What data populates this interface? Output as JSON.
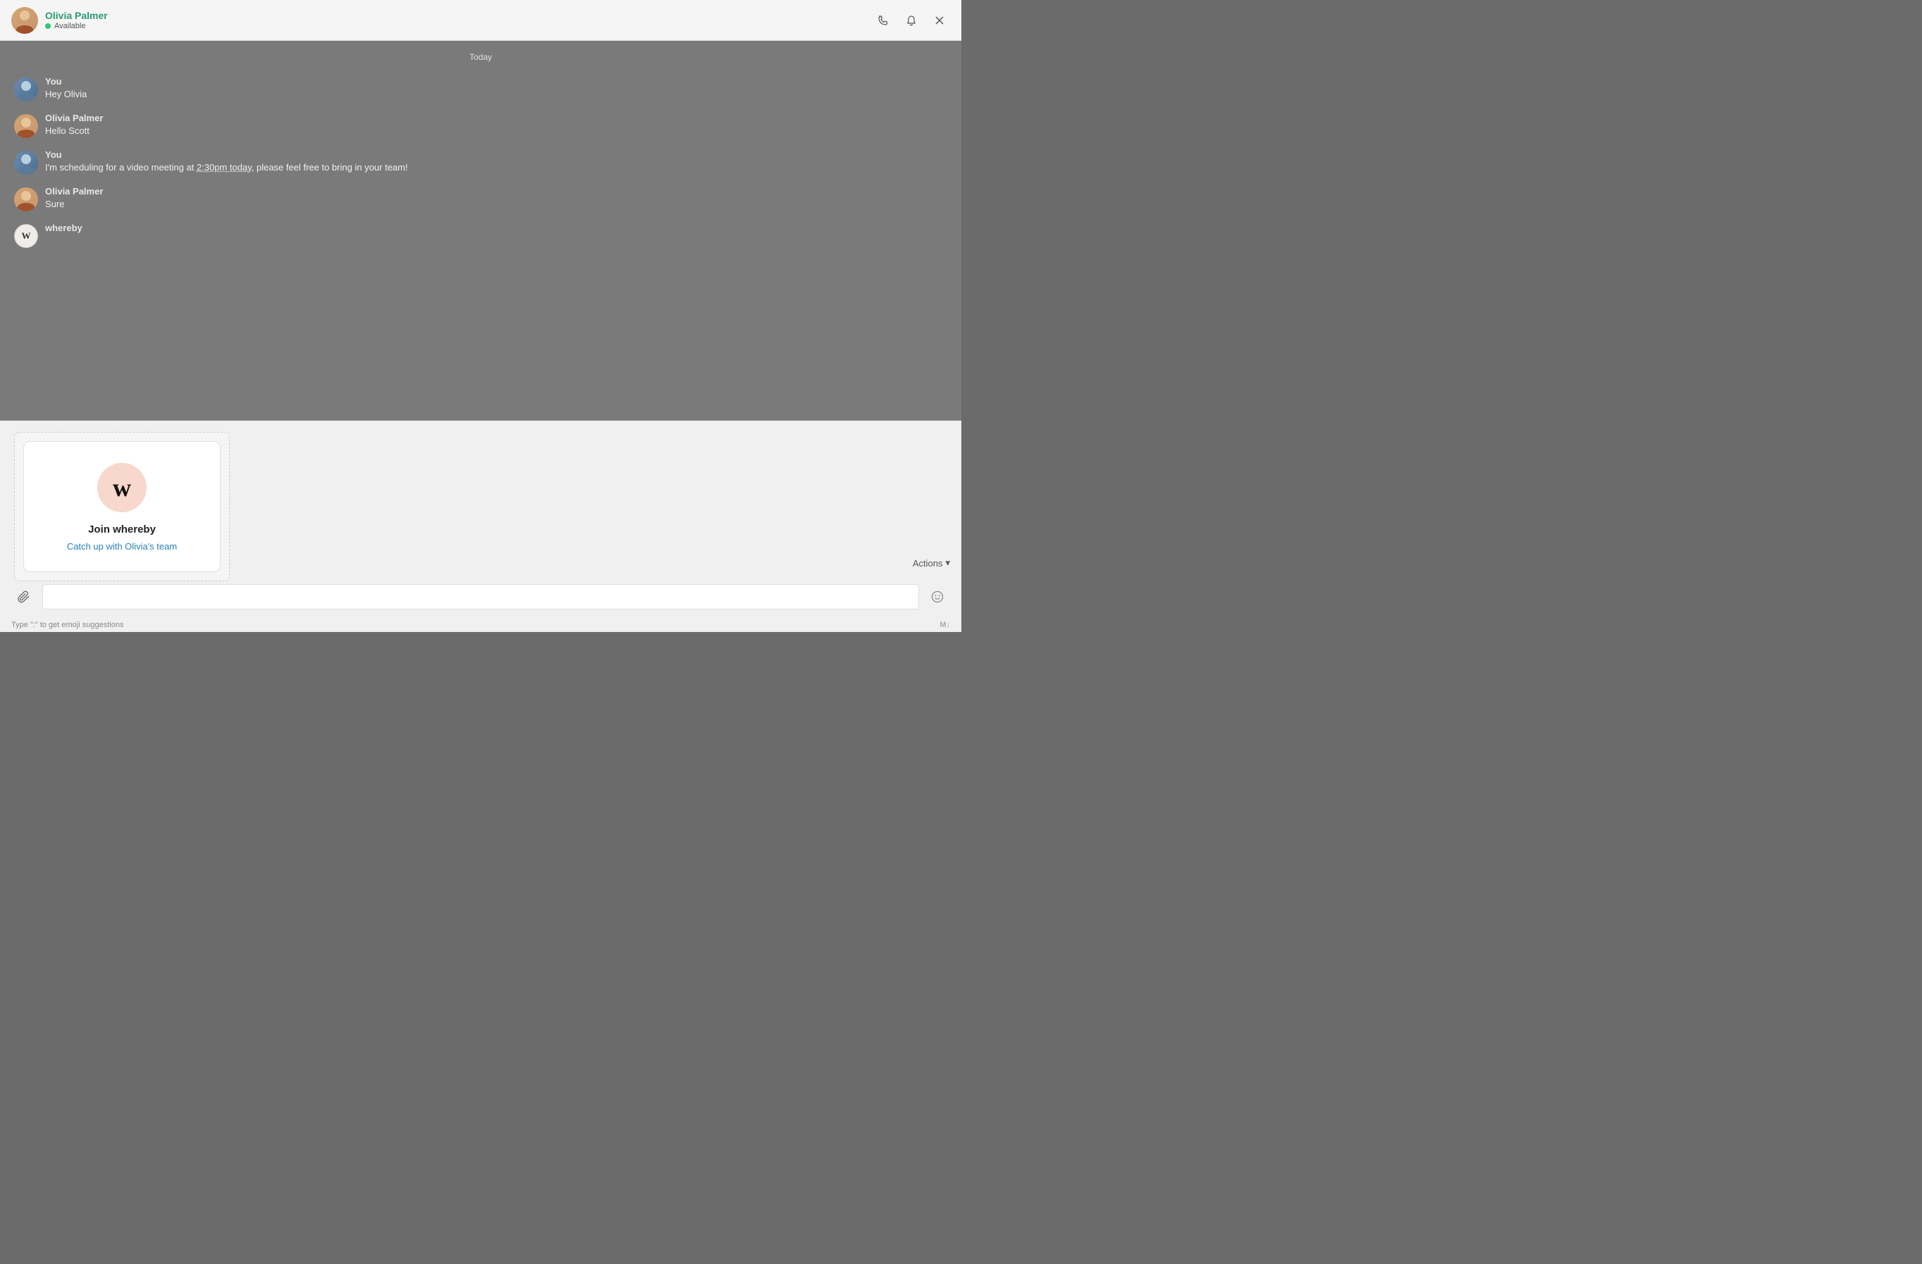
{
  "header": {
    "name": "Olivia Palmer",
    "status": "Available",
    "status_color": "#2ecc71",
    "actions": {
      "call_label": "call",
      "notification_label": "notification",
      "close_label": "close"
    }
  },
  "chat": {
    "date_divider": "Today",
    "messages": [
      {
        "id": 1,
        "sender": "You",
        "sender_type": "you",
        "text": "Hey Olivia"
      },
      {
        "id": 2,
        "sender": "Olivia Palmer",
        "sender_type": "olivia",
        "text": "Hello Scott"
      },
      {
        "id": 3,
        "sender": "You",
        "sender_type": "you",
        "text_before": "I'm scheduling for a video meeting at ",
        "time_link": "2:30pm today",
        "text_after": ", please feel free to bring in your team!"
      },
      {
        "id": 4,
        "sender": "Olivia Palmer",
        "sender_type": "olivia",
        "text": "Sure"
      },
      {
        "id": 5,
        "sender": "whereby",
        "sender_type": "whereby",
        "is_card": true
      }
    ]
  },
  "whereby_card": {
    "logo_letter": "w",
    "title": "Join whereby",
    "link_text": "Catch up with Olivia's team"
  },
  "actions_bar": {
    "label": "Actions",
    "chevron": "▾"
  },
  "input": {
    "placeholder": "",
    "attachment_icon": "📎",
    "emoji_icon": "🙂"
  },
  "footer": {
    "hint": "Type \":\" to get emoji suggestions",
    "markdown_label": "M↓"
  }
}
